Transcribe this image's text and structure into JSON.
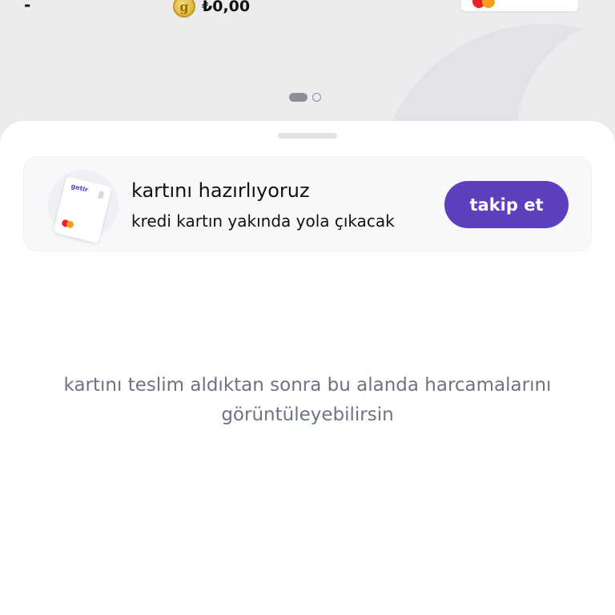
{
  "header": {
    "dash": "-",
    "coin_glyph": "g",
    "balance": "₺0,00"
  },
  "pager": {
    "total": 2,
    "active_index": 0
  },
  "card_status": {
    "title": "kartını hazırlıyoruz",
    "subtitle": "kredi kartın yakında yola çıkacak",
    "button_label": "takip et",
    "card_brand": "getir"
  },
  "spending": {
    "empty_message": "kartını teslim aldıktan sonra bu alanda harcamalarını görüntüleyebilirsin"
  },
  "colors": {
    "accent": "#5d3ebc",
    "muted_text": "#6c7384",
    "mastercard_red": "#e8202a",
    "mastercard_yellow": "#f79e1b"
  }
}
